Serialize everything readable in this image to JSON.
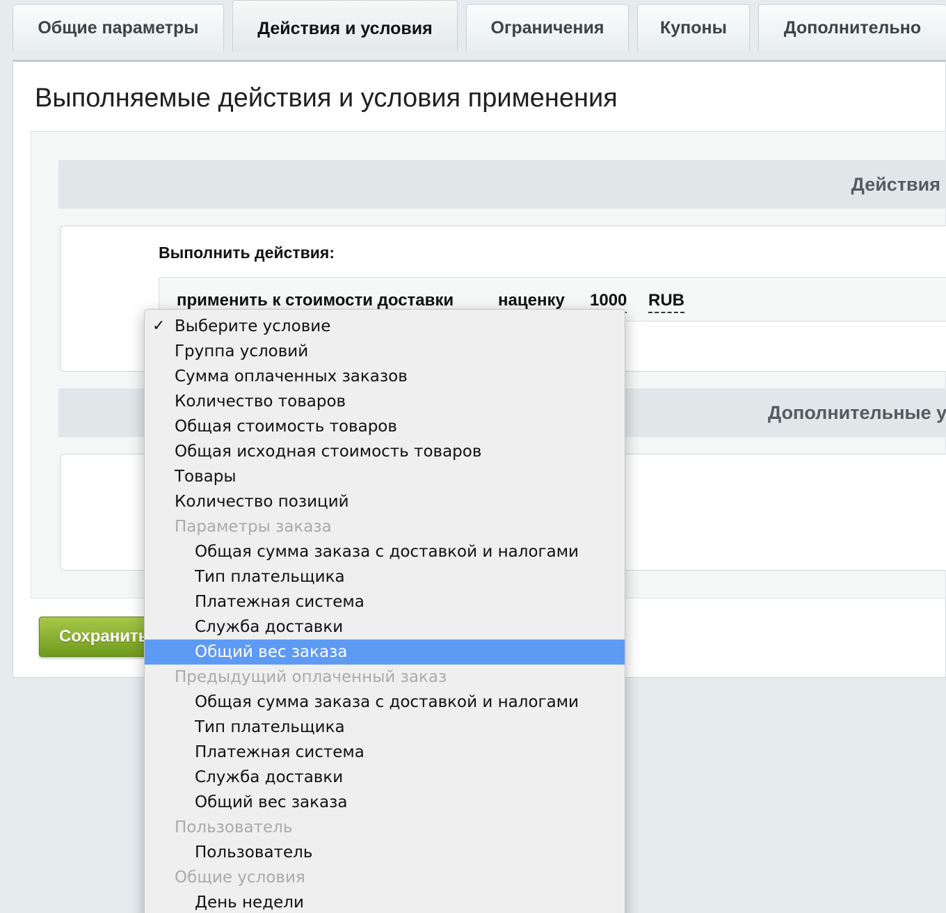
{
  "tabs": [
    {
      "label": "Общие параметры",
      "active": false
    },
    {
      "label": "Действия и условия",
      "active": true
    },
    {
      "label": "Ограничения",
      "active": false
    },
    {
      "label": "Купоны",
      "active": false
    },
    {
      "label": "Дополнительно",
      "active": false
    }
  ],
  "page": {
    "title": "Выполняемые действия и условия применения"
  },
  "actions_section": {
    "header": "Действия",
    "exec_label": "Выполнить действия:",
    "row": {
      "apply_text": "применить к стоимости доставки",
      "type_text": "наценку",
      "amount": "1000",
      "currency": "RUB"
    }
  },
  "extra_section": {
    "header": "Дополнительные у"
  },
  "save_button": {
    "label": "Сохранить"
  },
  "dropdown": {
    "check_icon": "✓",
    "options": [
      {
        "label": "Выберите условие",
        "kind": "option",
        "checked": true
      },
      {
        "label": "Группа условий",
        "kind": "option"
      },
      {
        "label": "Сумма оплаченных заказов",
        "kind": "option"
      },
      {
        "label": "Количество товаров",
        "kind": "option"
      },
      {
        "label": "Общая стоимость товаров",
        "kind": "option"
      },
      {
        "label": "Общая исходная стоимость товаров",
        "kind": "option"
      },
      {
        "label": "Товары",
        "kind": "option"
      },
      {
        "label": "Количество позиций",
        "kind": "option"
      },
      {
        "label": "Параметры заказа",
        "kind": "group"
      },
      {
        "label": "Общая сумма заказа с доставкой и налогами",
        "kind": "child"
      },
      {
        "label": "Тип плательщика",
        "kind": "child"
      },
      {
        "label": "Платежная система",
        "kind": "child"
      },
      {
        "label": "Служба доставки",
        "kind": "child"
      },
      {
        "label": "Общий вес заказа",
        "kind": "child",
        "selected": true
      },
      {
        "label": "Предыдущий оплаченный заказ",
        "kind": "group"
      },
      {
        "label": "Общая сумма заказа с доставкой и налогами",
        "kind": "child"
      },
      {
        "label": "Тип плательщика",
        "kind": "child"
      },
      {
        "label": "Платежная система",
        "kind": "child"
      },
      {
        "label": "Служба доставки",
        "kind": "child"
      },
      {
        "label": "Общий вес заказа",
        "kind": "child"
      },
      {
        "label": "Пользователь",
        "kind": "group"
      },
      {
        "label": "Пользователь",
        "kind": "child"
      },
      {
        "label": "Общие условия",
        "kind": "group"
      },
      {
        "label": "День недели",
        "kind": "child"
      }
    ]
  },
  "colors": {
    "highlight": "#5d9af4",
    "save_green": "#7fa82a"
  }
}
